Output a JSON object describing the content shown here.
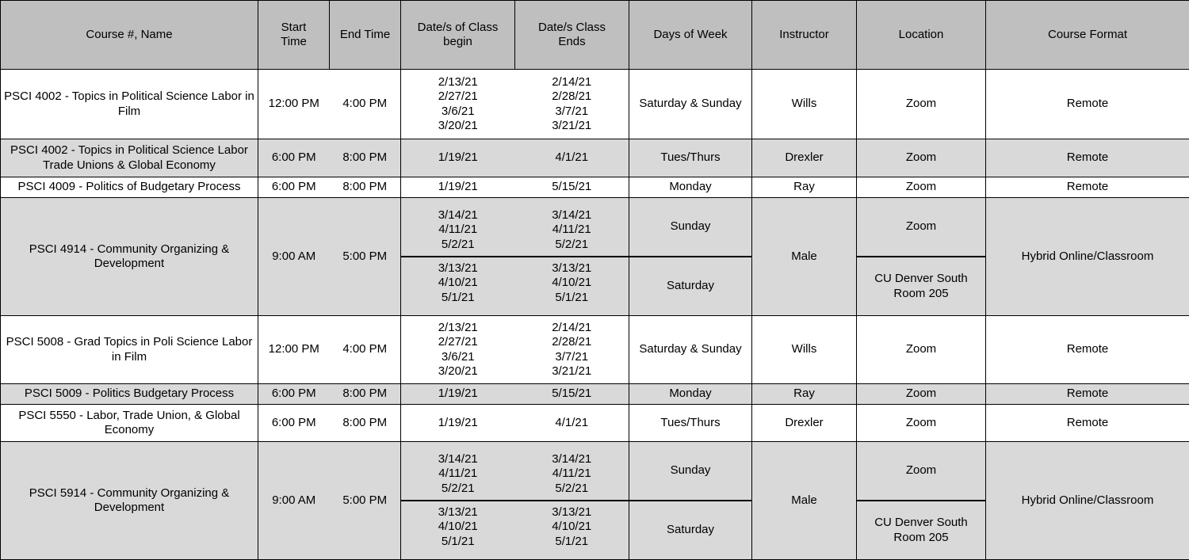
{
  "table": {
    "columns": [
      {
        "key": "course",
        "label": "Course #, Name"
      },
      {
        "key": "start_time",
        "label": "Start\nTime"
      },
      {
        "key": "end_time",
        "label": "End Time"
      },
      {
        "key": "date_begin",
        "label": "Date/s of Class\nbegin"
      },
      {
        "key": "date_ends",
        "label": "Date/s Class\nEnds"
      },
      {
        "key": "days",
        "label": "Days of Week"
      },
      {
        "key": "instructor",
        "label": "Instructor"
      },
      {
        "key": "location",
        "label": "Location"
      },
      {
        "key": "format",
        "label": "Course Format"
      }
    ],
    "colors": {
      "header_background": "#BFBFBF",
      "row_shaded_background": "#D9D9D9",
      "row_plain_background": "#FFFFFF",
      "border": "#000000",
      "text": "#000000"
    },
    "rows": [
      {
        "shaded": false,
        "course": "PSCI 4002 - Topics in Political Science Labor in Film",
        "start_time": "12:00 PM",
        "end_time": "4:00 PM",
        "date_begin": "2/13/21\n2/27/21\n3/6/21\n3/20/21",
        "date_ends": "2/14/21\n2/28/21\n3/7/21\n3/21/21",
        "days": "Saturday & Sunday",
        "instructor": "Wills",
        "location": "Zoom",
        "format": "Remote"
      },
      {
        "shaded": true,
        "course": "PSCI 4002 - Topics in Political Science Labor Trade Unions & Global Economy",
        "start_time": "6:00 PM",
        "end_time": "8:00 PM",
        "date_begin": "1/19/21",
        "date_ends": "4/1/21",
        "days": "Tues/Thurs",
        "instructor": "Drexler",
        "location": "Zoom",
        "format": "Remote"
      },
      {
        "shaded": false,
        "course": "PSCI 4009 - Politics of Budgetary Process",
        "start_time": "6:00 PM",
        "end_time": "8:00 PM",
        "date_begin": "1/19/21",
        "date_ends": "5/15/21",
        "days": "Monday",
        "instructor": "Ray",
        "location": "Zoom",
        "format": "Remote"
      },
      {
        "shaded": true,
        "split": true,
        "course": "PSCI 4914 - Community Organizing & Development",
        "start_time": "9:00 AM",
        "end_time": "5:00 PM",
        "instructor": "Male",
        "format": "Hybrid Online/Classroom",
        "subrows": [
          {
            "date_begin": "3/14/21\n4/11/21\n5/2/21",
            "date_ends": "3/14/21\n4/11/21\n5/2/21",
            "days": "Sunday",
            "location": "Zoom"
          },
          {
            "date_begin": "3/13/21\n4/10/21\n5/1/21",
            "date_ends": "3/13/21\n4/10/21\n5/1/21",
            "days": "Saturday",
            "location": "CU Denver South\nRoom 205"
          }
        ]
      },
      {
        "shaded": false,
        "course": "PSCI 5008 - Grad Topics in Poli Science Labor in Film",
        "start_time": "12:00 PM",
        "end_time": "4:00 PM",
        "date_begin": "2/13/21\n2/27/21\n3/6/21\n3/20/21",
        "date_ends": "2/14/21\n2/28/21\n3/7/21\n3/21/21",
        "days": "Saturday & Sunday",
        "instructor": "Wills",
        "location": "Zoom",
        "format": "Remote"
      },
      {
        "shaded": true,
        "course": "PSCI 5009 - Politics Budgetary Process",
        "start_time": "6:00 PM",
        "end_time": "8:00 PM",
        "date_begin": "1/19/21",
        "date_ends": "5/15/21",
        "days": "Monday",
        "instructor": "Ray",
        "location": "Zoom",
        "format": "Remote"
      },
      {
        "shaded": false,
        "course": "PSCI 5550 - Labor, Trade Union, & Global Economy",
        "start_time": "6:00 PM",
        "end_time": "8:00 PM",
        "date_begin": "1/19/21",
        "date_ends": "4/1/21",
        "days": "Tues/Thurs",
        "instructor": "Drexler",
        "location": "Zoom",
        "format": "Remote"
      },
      {
        "shaded": true,
        "split": true,
        "course": "PSCI 5914 - Community Organizing & Development",
        "start_time": "9:00 AM",
        "end_time": "5:00 PM",
        "instructor": "Male",
        "format": "Hybrid Online/Classroom",
        "subrows": [
          {
            "date_begin": "3/14/21\n4/11/21\n5/2/21",
            "date_ends": "3/14/21\n4/11/21\n5/2/21",
            "days": "Sunday",
            "location": "Zoom"
          },
          {
            "date_begin": "3/13/21\n4/10/21\n5/1/21",
            "date_ends": "3/13/21\n4/10/21\n5/1/21",
            "days": "Saturday",
            "location": "CU Denver South\nRoom 205"
          }
        ]
      }
    ]
  }
}
